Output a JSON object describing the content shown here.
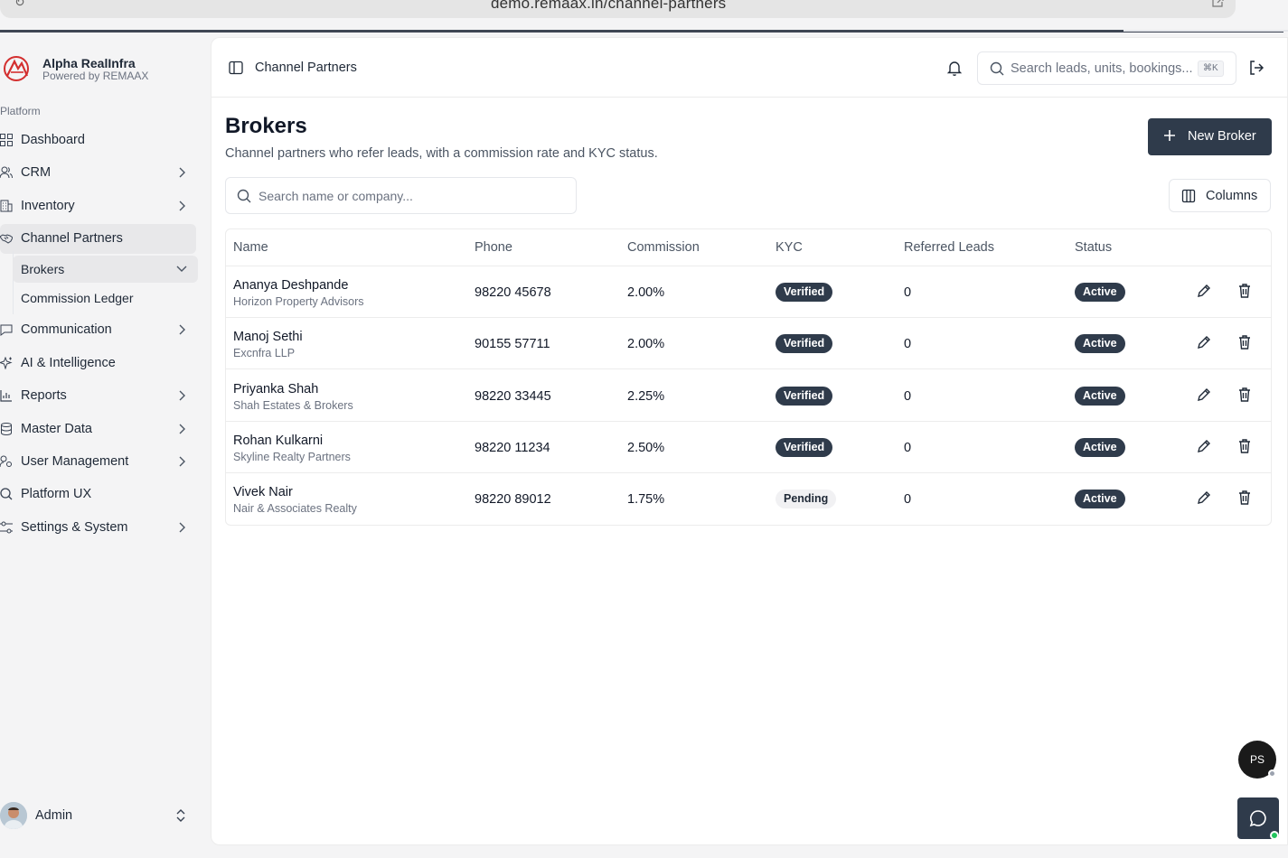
{
  "browser": {
    "url": "demo.remaax.in/channel-partners"
  },
  "brand": {
    "name": "Alpha RealInfra",
    "tagline": "Powered by REMAAX"
  },
  "sidebar": {
    "section_label": "Platform",
    "items": [
      {
        "label": "Dashboard",
        "icon": "grid-icon",
        "has_chevron": false
      },
      {
        "label": "CRM",
        "icon": "users-icon",
        "has_chevron": true
      },
      {
        "label": "Inventory",
        "icon": "building-icon",
        "has_chevron": true
      },
      {
        "label": "Channel Partners",
        "icon": "handshake-icon",
        "has_chevron": false,
        "active": true
      },
      {
        "label": "Communication",
        "icon": "message-icon",
        "has_chevron": true
      },
      {
        "label": "AI & Intelligence",
        "icon": "sparkles-icon",
        "has_chevron": false
      },
      {
        "label": "Reports",
        "icon": "bar-chart-icon",
        "has_chevron": true
      },
      {
        "label": "Master Data",
        "icon": "database-icon",
        "has_chevron": true
      },
      {
        "label": "User Management",
        "icon": "user-cog-icon",
        "has_chevron": true
      },
      {
        "label": "Platform UX",
        "icon": "search-icon",
        "has_chevron": false
      },
      {
        "label": "Settings & System",
        "icon": "sliders-icon",
        "has_chevron": true
      }
    ],
    "sub_items": [
      {
        "label": "Brokers",
        "active": true
      },
      {
        "label": "Commission Ledger"
      }
    ],
    "user": {
      "label": "Admin"
    }
  },
  "topbar": {
    "breadcrumb": "Channel Partners",
    "search_placeholder": "Search leads, units, bookings...",
    "shortcut": "⌘K"
  },
  "page": {
    "title": "Brokers",
    "description": "Channel partners who refer leads, with a commission rate and KYC status.",
    "new_button": "New Broker",
    "filter_placeholder": "Search name or company...",
    "columns_button": "Columns"
  },
  "table": {
    "headers": [
      "Name",
      "Phone",
      "Commission",
      "KYC",
      "Referred Leads",
      "Status"
    ],
    "rows": [
      {
        "name": "Ananya Deshpande",
        "company": "Horizon Property Advisors",
        "phone": "98220 45678",
        "commission": "2.00%",
        "kyc": "Verified",
        "leads": "0",
        "status": "Active"
      },
      {
        "name": "Manoj Sethi",
        "company": "Excnfra LLP",
        "phone": "90155 57711",
        "commission": "2.00%",
        "kyc": "Verified",
        "leads": "0",
        "status": "Active"
      },
      {
        "name": "Priyanka Shah",
        "company": "Shah Estates & Brokers",
        "phone": "98220 33445",
        "commission": "2.25%",
        "kyc": "Verified",
        "leads": "0",
        "status": "Active"
      },
      {
        "name": "Rohan Kulkarni",
        "company": "Skyline Realty Partners",
        "phone": "98220 11234",
        "commission": "2.50%",
        "kyc": "Verified",
        "leads": "0",
        "status": "Active"
      },
      {
        "name": "Vivek Nair",
        "company": "Nair & Associates Realty",
        "phone": "98220 89012",
        "commission": "1.75%",
        "kyc": "Pending",
        "leads": "0",
        "status": "Active"
      }
    ]
  },
  "floating": {
    "avatar_initials": "PS"
  },
  "colors": {
    "primary": "#2f3b4b",
    "brand_red": "#d32f2f",
    "online": "#22c55e"
  }
}
